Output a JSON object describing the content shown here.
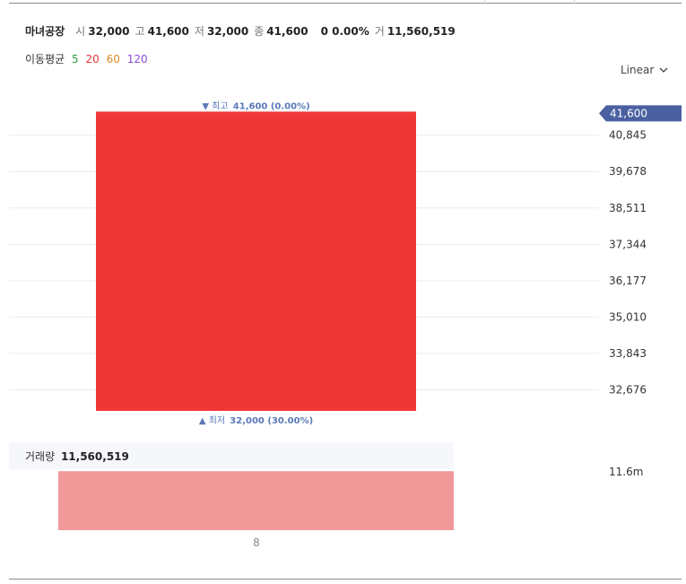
{
  "header": {
    "name": "마녀공장",
    "open_label": "시",
    "open": "32,000",
    "high_label": "고",
    "high": "41,600",
    "low_label": "저",
    "low": "32,000",
    "close_label": "종",
    "close": "41,600",
    "change": "0 0.00%",
    "volume_label": "거",
    "volume": "11,560,519"
  },
  "moving_average": {
    "label": "이동평균",
    "periods": [
      {
        "label": "5",
        "color": "#2ea043"
      },
      {
        "label": "20",
        "color": "#e5393b"
      },
      {
        "label": "60",
        "color": "#e38b2a"
      },
      {
        "label": "120",
        "color": "#8a4ad6"
      }
    ]
  },
  "scale_toggle": {
    "label": "Linear",
    "icon": "chevron-down-icon"
  },
  "price_marker": {
    "label": "41,600",
    "color": "#4a60a0"
  },
  "annotations": {
    "high_prefix": "▼ 최고",
    "high_value": "41,600 (0.00%)",
    "low_prefix": "▲ 최저",
    "low_value": "32,000 (30.00%)"
  },
  "volume_panel": {
    "label": "거래량",
    "value": "11,560,519",
    "axis_label": "11.6m"
  },
  "x_axis": {
    "label": "8"
  },
  "chart_data": {
    "type": "candlestick",
    "scale": "linear",
    "ylim": [
      31800,
      41900
    ],
    "y_ticks": [
      {
        "label": "40,845",
        "value": 40845
      },
      {
        "label": "39,678",
        "value": 39678
      },
      {
        "label": "38,511",
        "value": 38511
      },
      {
        "label": "37,344",
        "value": 37344
      },
      {
        "label": "36,177",
        "value": 36177
      },
      {
        "label": "35,010",
        "value": 35010
      },
      {
        "label": "33,843",
        "value": 33843
      },
      {
        "label": "32,676",
        "value": 32676
      }
    ],
    "x_ticks": [
      "8"
    ],
    "candles": [
      {
        "x": "8",
        "open": 32000,
        "high": 41600,
        "low": 32000,
        "close": 41600,
        "volume": 11560519
      }
    ],
    "up_color": "#ef3737",
    "volume_color": "#f19999",
    "volume_max": 11600000,
    "grid": true
  }
}
